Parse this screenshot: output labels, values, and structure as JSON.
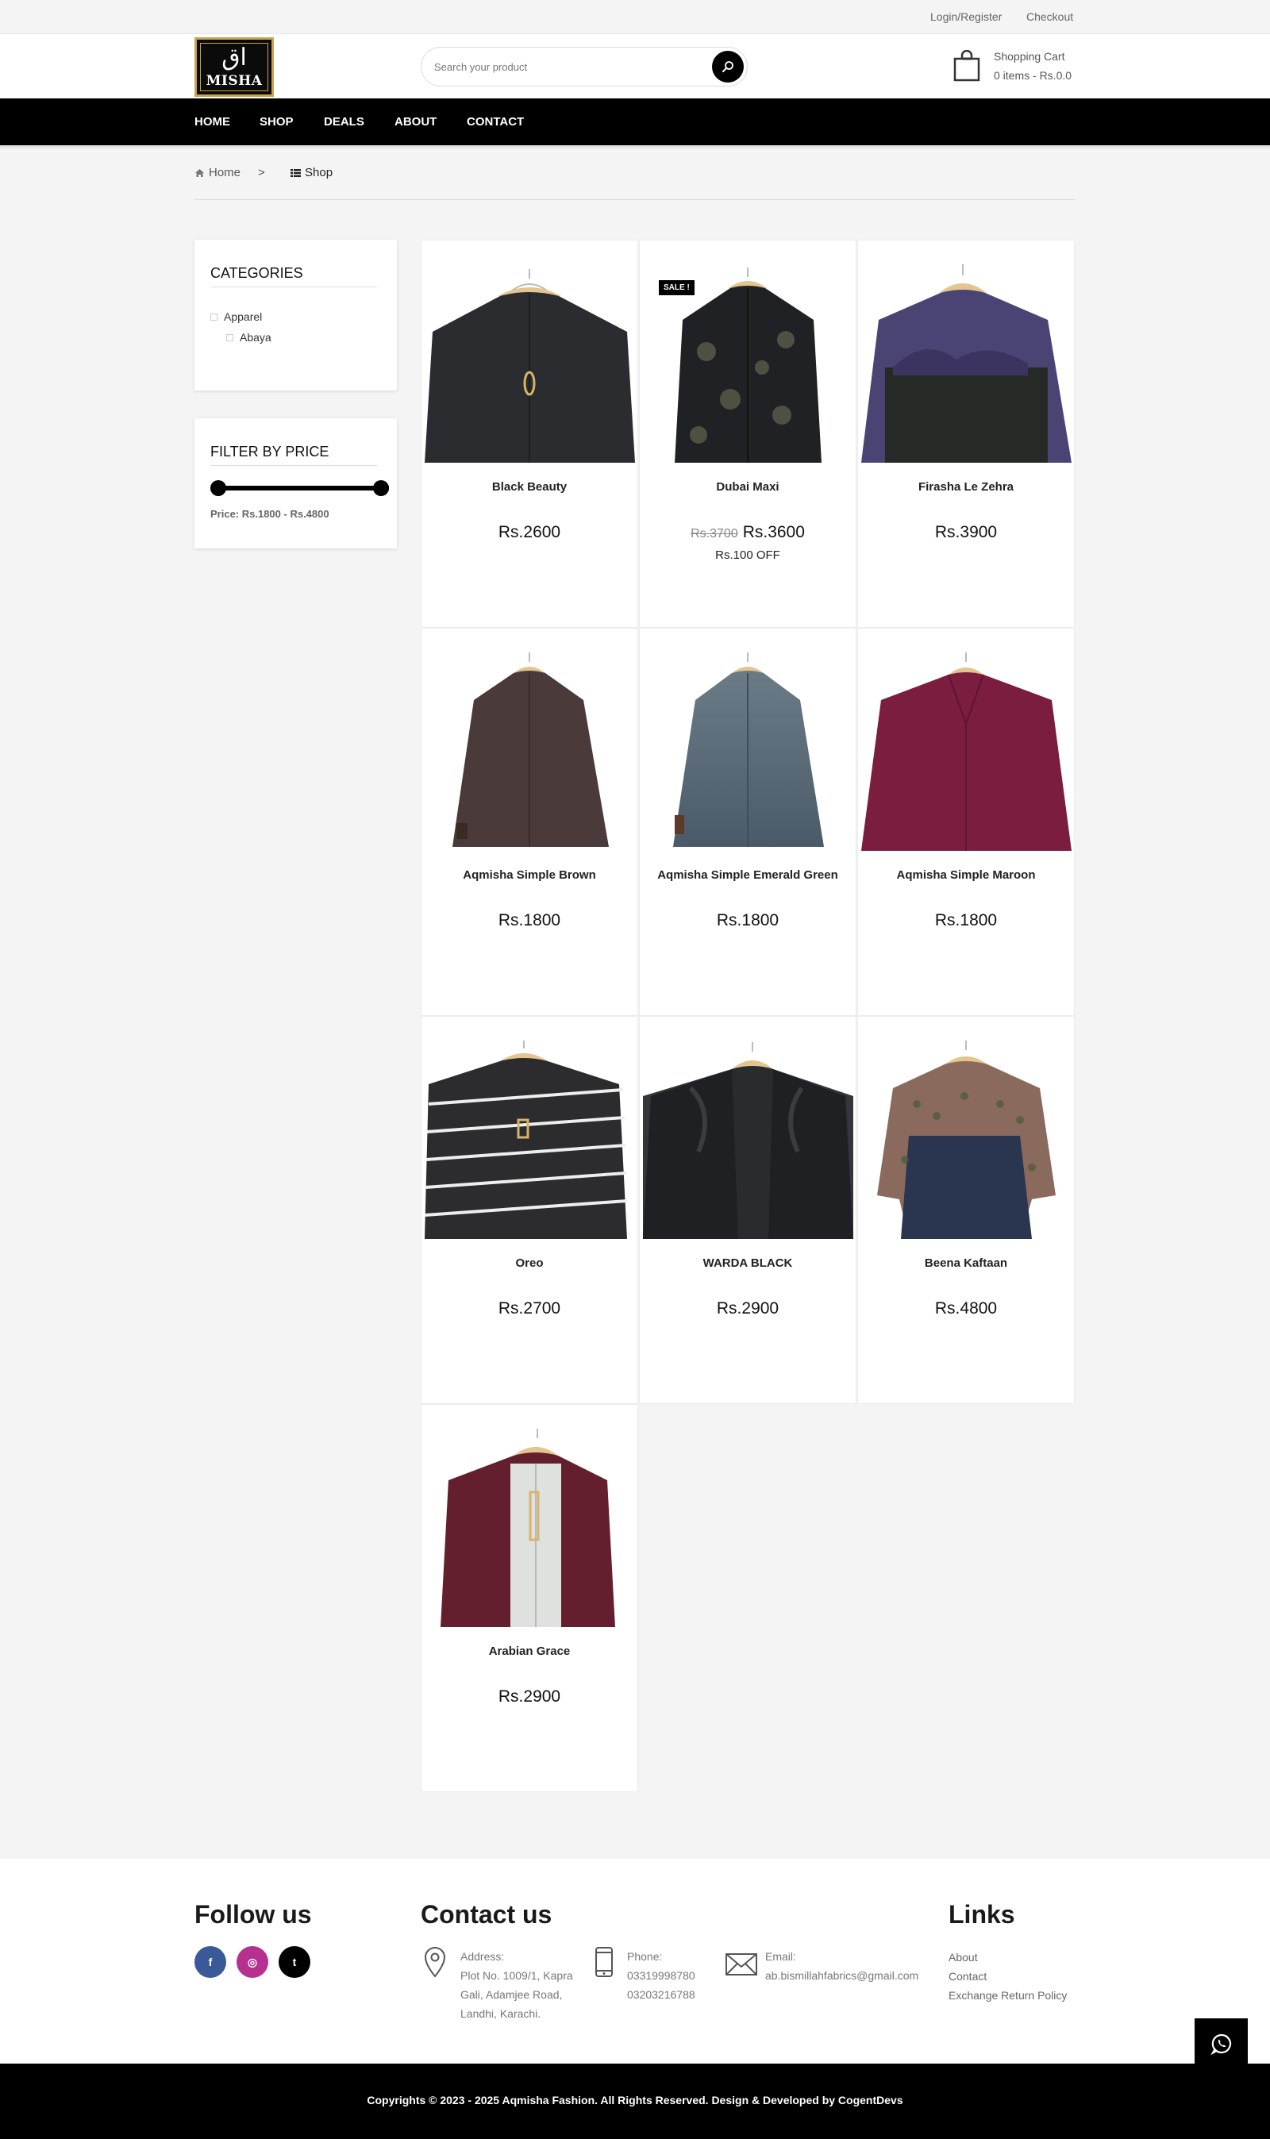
{
  "topbar": {
    "login": "Login/Register",
    "checkout": "Checkout"
  },
  "logo": {
    "arabic": "اق",
    "text": "MISHA"
  },
  "search": {
    "placeholder": "Search your product"
  },
  "cart": {
    "title": "Shopping Cart",
    "summary": "0 items - Rs.0.0"
  },
  "nav": {
    "items": [
      "HOME",
      "SHOP",
      "DEALS",
      "ABOUT",
      "CONTACT"
    ]
  },
  "breadcrumb": {
    "home": "Home",
    "separator": ">",
    "current": "Shop"
  },
  "categories": {
    "title": "CATEGORIES",
    "items": [
      "Apparel",
      "Abaya"
    ]
  },
  "price_filter": {
    "title": "FILTER BY PRICE",
    "text": "Price: Rs.1800 - Rs.4800",
    "min": 1800,
    "max": 4800,
    "selected_min": 1800,
    "selected_max": 4800
  },
  "products": [
    {
      "name": "Black Beauty",
      "price": "Rs.2600"
    },
    {
      "name": "Dubai Maxi",
      "old_price": "Rs.3700",
      "price": "Rs.3600",
      "discount": "Rs.100 OFF",
      "badge": "SALE !"
    },
    {
      "name": "Firasha Le Zehra",
      "price": "Rs.3900"
    },
    {
      "name": "Aqmisha Simple Brown",
      "price": "Rs.1800"
    },
    {
      "name": "Aqmisha Simple Emerald Green",
      "price": "Rs.1800"
    },
    {
      "name": "Aqmisha Simple Maroon",
      "price": "Rs.1800"
    },
    {
      "name": "Oreo",
      "price": "Rs.2700"
    },
    {
      "name": "WARDA BLACK",
      "price": "Rs.2900"
    },
    {
      "name": "Beena Kaftaan",
      "price": "Rs.4800"
    },
    {
      "name": "Arabian Grace",
      "price": "Rs.2900"
    }
  ],
  "footer": {
    "follow_title": "Follow us",
    "social": [
      {
        "icon": "facebook-icon",
        "glyph": "f",
        "color": "#3b5998"
      },
      {
        "icon": "instagram-icon",
        "glyph": "◎",
        "color": "#b5308f"
      },
      {
        "icon": "tumblr-icon",
        "glyph": "t",
        "color": "#000000"
      }
    ],
    "contact_title": "Contact us",
    "address_label": "Address:",
    "address_lines": [
      "Plot No. 1009/1, Kapra",
      "Gali, Adamjee Road,",
      "Landhi, Karachi."
    ],
    "phone_label": "Phone:",
    "phones": [
      "03319998780",
      "03203216788"
    ],
    "email_label": "Email:",
    "email": "ab.bismillahfabrics@gmail.com",
    "links_title": "Links",
    "links": [
      "About",
      "Contact",
      "Exchange Return Policy"
    ],
    "copyright": "Copyrights © 2023 - 2025 Aqmisha Fashion. All Rights Reserved. Design & Developed by CogentDevs"
  },
  "colors": {
    "accent": "#000000",
    "logo_gold": "#c9a24d",
    "background": "#f4f4f4"
  }
}
